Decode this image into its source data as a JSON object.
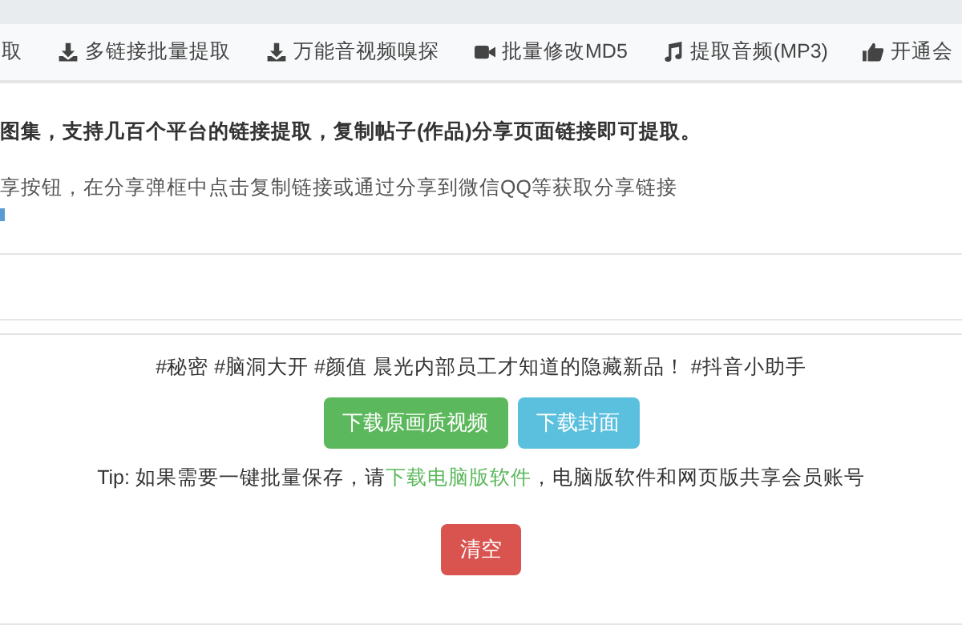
{
  "nav": [
    {
      "label": "取",
      "kind": "plain"
    },
    {
      "label": "多链接批量提取",
      "kind": "download"
    },
    {
      "label": "万能音视频嗅探",
      "kind": "download"
    },
    {
      "label": "批量修改MD5",
      "kind": "video"
    },
    {
      "label": "提取音频(MP3)",
      "kind": "audio"
    },
    {
      "label": "开通会",
      "kind": "vip"
    }
  ],
  "intro": {
    "headline": "图集，支持几百个平台的链接提取，复制帖子(作品)分享页面链接即可提取。",
    "hint": "享按钮，在分享弹框中点击复制链接或通过分享到微信QQ等获取分享链接"
  },
  "result": {
    "title": "#秘密 #脑洞大开 #颜值 晨光内部员工才知道的隐藏新品！ #抖音小助手",
    "buttons": [
      {
        "label": "下载原画质视频",
        "kind": "success"
      },
      {
        "label": "下载封面",
        "kind": "info"
      }
    ],
    "tip": "Tip: 如果需要一键批量保存，请",
    "tip_link": "下载电脑版软件",
    "tip_tail": "，电脑版软件和网页版共享会员账号",
    "clear": "清空"
  }
}
